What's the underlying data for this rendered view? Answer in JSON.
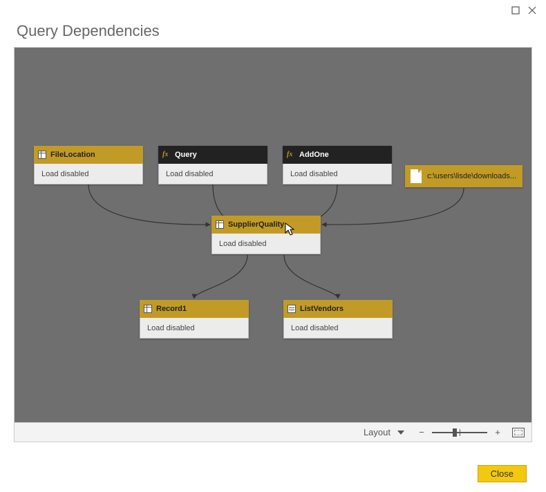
{
  "dialog": {
    "title": "Query Dependencies"
  },
  "statusbar": {
    "layout_label": "Layout"
  },
  "buttons": {
    "close": "Close"
  },
  "nodes": {
    "fileLocation": {
      "title": "FileLocation",
      "status": "Load disabled"
    },
    "query": {
      "title": "Query",
      "status": "Load disabled"
    },
    "addOne": {
      "title": "AddOne",
      "status": "Load disabled"
    },
    "supplier": {
      "title": "SupplierQuality",
      "status": "Load disabled"
    },
    "record1": {
      "title": "Record1",
      "status": "Load disabled"
    },
    "listVendors": {
      "title": "ListVendors",
      "status": "Load disabled"
    }
  },
  "file": {
    "path": "c:\\users\\lisde\\downloads..."
  },
  "arrowhead": "▶"
}
